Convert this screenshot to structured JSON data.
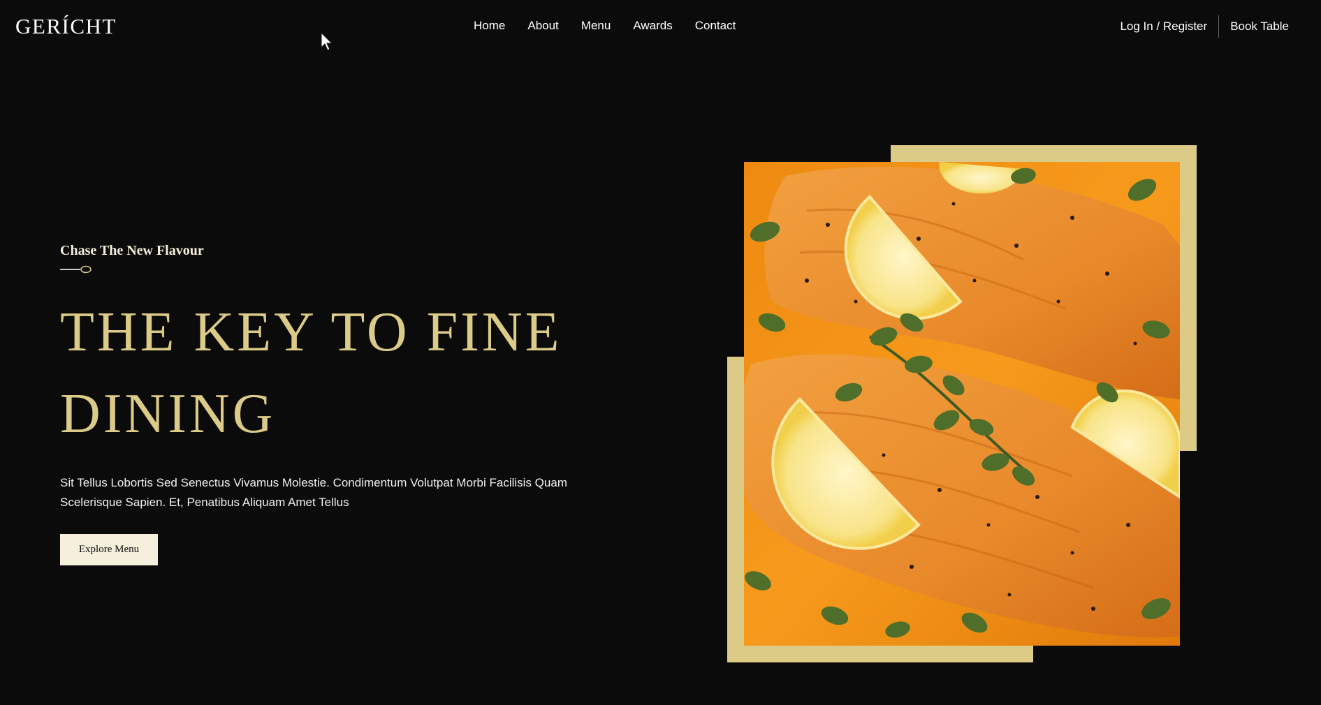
{
  "brand": {
    "name": "GERÍCHT"
  },
  "nav": {
    "links": [
      "Home",
      "About",
      "Menu",
      "Awards",
      "Contact"
    ],
    "login": "Log In / Register",
    "book": "Book Table"
  },
  "hero": {
    "subtitle": "Chase The New Flavour",
    "title": "THE KEY TO FINE DINING",
    "description": "Sit Tellus Lobortis Sed Senectus Vivamus Molestie. Condimentum Volutpat Morbi Facilisis Quam Scelerisque Sapien. Et, Penatibus Aliquam Amet Tellus",
    "button": "Explore Menu"
  },
  "colors": {
    "background": "#0b0b0b",
    "gold": "#dcca87",
    "crimson": "#f5efdb"
  },
  "icons": {
    "spoon": "spoon-icon",
    "cursor": "mouse-pointer-icon"
  }
}
